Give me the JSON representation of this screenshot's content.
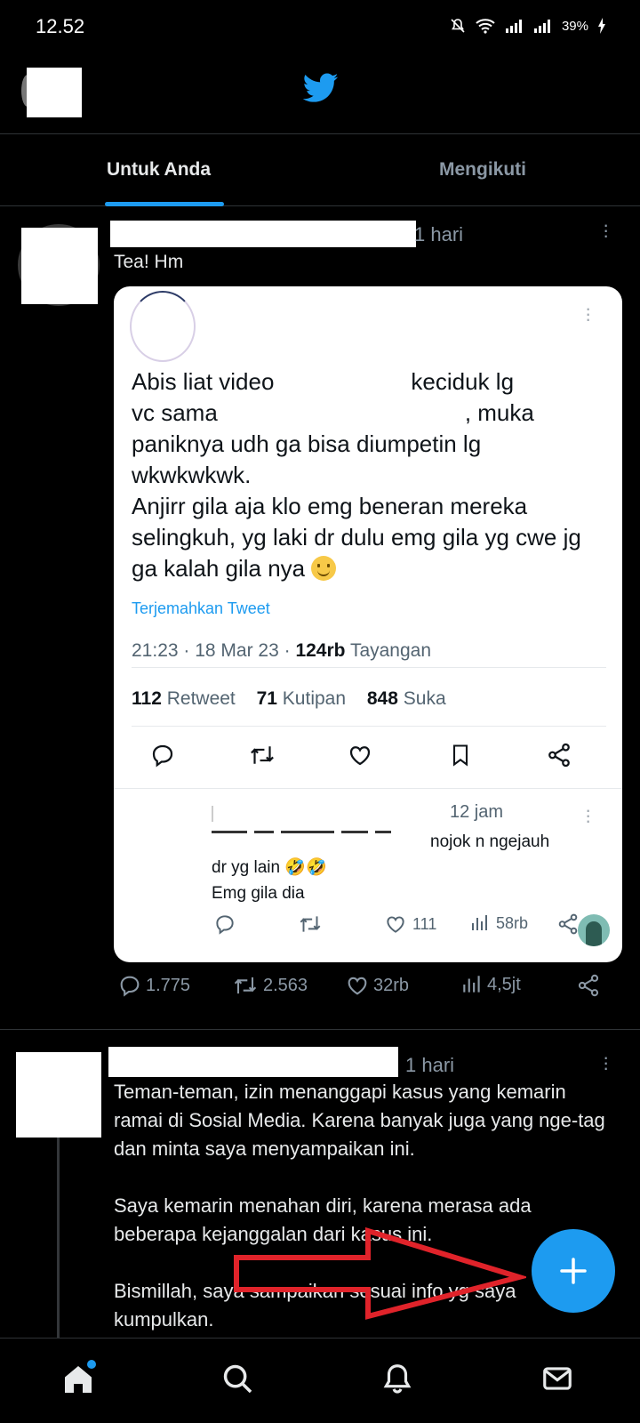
{
  "status_bar": {
    "time": "12.52",
    "battery": "39%"
  },
  "colors": {
    "accent": "#1d9bf0",
    "annotation_arrow": "#e0232a"
  },
  "tabs": [
    {
      "label": "Untuk Anda",
      "active": true
    },
    {
      "label": "Mengikuti",
      "active": false
    }
  ],
  "tweet1": {
    "time": "1 hari",
    "text": "Tea! Hm",
    "quoted": {
      "lines": [
        {
          "a": "Abis liat video",
          "b": "keciduk lg"
        },
        {
          "a": "vc sama",
          "b": ", muka"
        },
        {
          "a": "paniknya udh ga bisa diumpetin lg"
        },
        {
          "a": "wkwkwkwk."
        },
        {
          "a": "Anjirr gila aja klo emg beneran mereka"
        },
        {
          "a": "selingkuh, yg laki dr dulu emg gila yg cwe jg"
        },
        {
          "a": "ga kalah gila nya"
        }
      ],
      "translate": "Terjemahkan Tweet",
      "meta": {
        "datetime": "21:23 · 18 Mar 23 · ",
        "views": "124rb",
        "views_label": " Tayangan"
      },
      "stats": {
        "retweets": "112",
        "retweets_label": " Retweet",
        "quotes": "71",
        "quotes_label": " Kutipan",
        "likes": "848",
        "likes_label": " Suka"
      },
      "reply": {
        "time": "12 jam",
        "line1": "nojok n ngejauh",
        "line2": "dr yg lain 🤣🤣",
        "line3": "Emg gila dia",
        "likes": "111",
        "views": "58rb"
      }
    },
    "actions": {
      "replies": "1.775",
      "retweets": "2.563",
      "likes": "32rb",
      "views": "4,5jt"
    }
  },
  "tweet2": {
    "time": "1 hari",
    "paragraphs": [
      "Teman-teman, izin menanggapi kasus yang kemarin ramai di Sosial Media. Karena banyak juga yang nge-tag dan minta saya menyampaikan ini.",
      "Saya kemarin menahan diri, karena merasa ada beberapa kejanggalan dari kasus ini.",
      "Bismillah, saya sampaikan sesuai info yg saya kumpulkan."
    ]
  },
  "icons": {
    "header": "twitter-bird-icon",
    "fab": "plus-icon",
    "nav": [
      "home-icon",
      "search-icon",
      "bell-icon",
      "mail-icon"
    ]
  }
}
